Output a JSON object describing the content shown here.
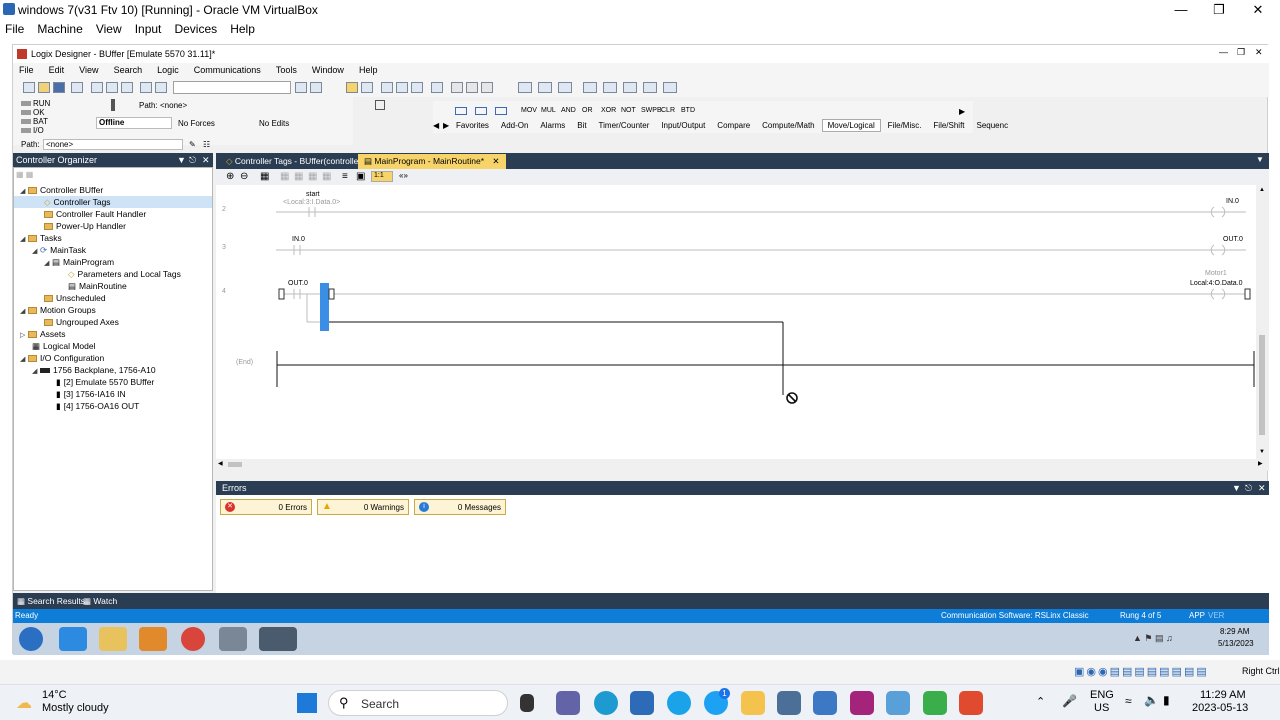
{
  "vbox": {
    "title": "windows 7(v31 Ftv 10) [Running] - Oracle VM VirtualBox",
    "menu": [
      "File",
      "Machine",
      "View",
      "Input",
      "Devices",
      "Help"
    ]
  },
  "logix": {
    "title": "Logix Designer - BUffer [Emulate 5570 31.11]*",
    "menu": [
      "File",
      "Edit",
      "View",
      "Search",
      "Logic",
      "Communications",
      "Tools",
      "Window",
      "Help"
    ],
    "status_leds": [
      "RUN",
      "OK",
      "BAT",
      "I/O"
    ],
    "path_label": "Path:",
    "path_value": "<none>",
    "mode": "Offline",
    "forces": "No Forces",
    "edits": "No Edits",
    "path2_label": "Path:",
    "path2_value": "<none>",
    "instructions": [
      "MOV",
      "MUL",
      "AND",
      "OR",
      "XOR",
      "NOT",
      "SWPB",
      "CLR",
      "BTD"
    ],
    "instruction_tabs": [
      "Favorites",
      "Add-On",
      "Alarms",
      "Bit",
      "Timer/Counter",
      "Input/Output",
      "Compare",
      "Compute/Math",
      "Move/Logical",
      "File/Misc.",
      "File/Shift",
      "Sequenc"
    ],
    "selected_instruction_tab": "Move/Logical"
  },
  "organizer": {
    "title": "Controller Organizer",
    "nodes": [
      {
        "label": "Controller BUffer"
      },
      {
        "label": "Controller Tags"
      },
      {
        "label": "Controller Fault Handler"
      },
      {
        "label": "Power-Up Handler"
      },
      {
        "label": "Tasks"
      },
      {
        "label": "MainTask"
      },
      {
        "label": "MainProgram"
      },
      {
        "label": "Parameters and Local Tags"
      },
      {
        "label": "MainRoutine"
      },
      {
        "label": "Unscheduled"
      },
      {
        "label": "Motion Groups"
      },
      {
        "label": "Ungrouped Axes"
      },
      {
        "label": "Assets"
      },
      {
        "label": "Logical Model"
      },
      {
        "label": "I/O Configuration"
      },
      {
        "label": "1756 Backplane, 1756-A10"
      },
      {
        "label": "[2] Emulate 5570 BUffer"
      },
      {
        "label": "[3] 1756-IA16 IN"
      },
      {
        "label": "[4] 1756-OA16 OUT"
      }
    ]
  },
  "editor": {
    "tabs": [
      "Controller Tags - BUffer(controller)",
      "MainProgram - MainRoutine*"
    ],
    "zoom_value": "1:1",
    "rungs": [
      {
        "num": "2",
        "contact_tag": "start",
        "contact_alias": "<Local:3:I.Data.0>",
        "coil_tag": "IN.0"
      },
      {
        "num": "3",
        "contact_tag": "IN.0",
        "coil_tag": "OUT.0"
      },
      {
        "num": "4",
        "contact_tag": "OUT.0",
        "coil_desc": "Motor1",
        "coil_tag": "Local:4:O.Data.0"
      }
    ],
    "end_label": "(End)"
  },
  "errors": {
    "title": "Errors",
    "errors": "0 Errors",
    "warnings": "0 Warnings",
    "messages": "0 Messages"
  },
  "bottom_tabs": [
    "Search Results",
    "Watch"
  ],
  "status_bar": {
    "left": "Ready",
    "comm": "Communication Software: RSLinx Classic",
    "rung": "Rung 4 of 5",
    "app": "APP",
    "ver": "VER"
  },
  "guest_clock": {
    "time": "8:29 AM",
    "date": "5/13/2023"
  },
  "host_status_right": "Right Ctrl",
  "host_taskbar": {
    "weather_temp": "14°C",
    "weather_desc": "Mostly cloudy",
    "search_placeholder": "Search",
    "lang": "ENG",
    "region": "US",
    "time": "11:29 AM",
    "date": "2023-05-13",
    "notif_badge": "1"
  }
}
